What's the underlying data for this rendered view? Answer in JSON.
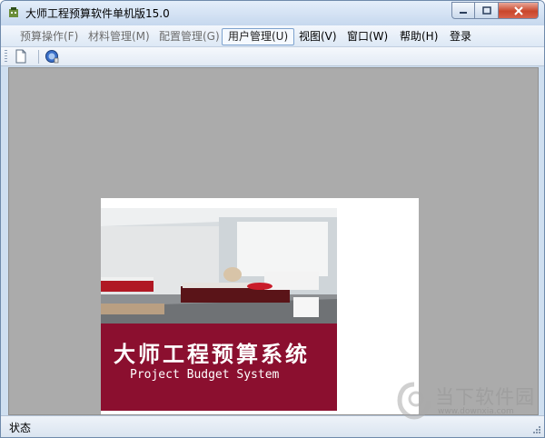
{
  "window": {
    "title": "大师工程预算软件单机版15.0"
  },
  "menu": {
    "items": [
      {
        "label": "预算操作(F)",
        "state": "disabled"
      },
      {
        "label": "材料管理(M)",
        "state": "disabled"
      },
      {
        "label": "配置管理(G)",
        "state": "disabled"
      },
      {
        "label": "用户管理(U)",
        "state": "active"
      },
      {
        "label": "视图(V)",
        "state": "normal"
      },
      {
        "label": "窗口(W)",
        "state": "normal"
      },
      {
        "label": "帮助(H)",
        "state": "normal"
      },
      {
        "label": "登录",
        "state": "normal"
      }
    ]
  },
  "toolbar": {
    "buttons": [
      {
        "icon": "new-document-icon"
      },
      {
        "icon": "help-about-icon"
      }
    ]
  },
  "splash": {
    "title": "大师工程预算系统",
    "subtitle": "Project Budget System",
    "banner_color": "#8b0f2f"
  },
  "status": {
    "text": "状态"
  },
  "watermark": {
    "text": "当下软件园",
    "url": "www.downxia.com"
  },
  "colors": {
    "mdi_background": "#ababab",
    "menu_highlight_border": "#7da2ce"
  }
}
